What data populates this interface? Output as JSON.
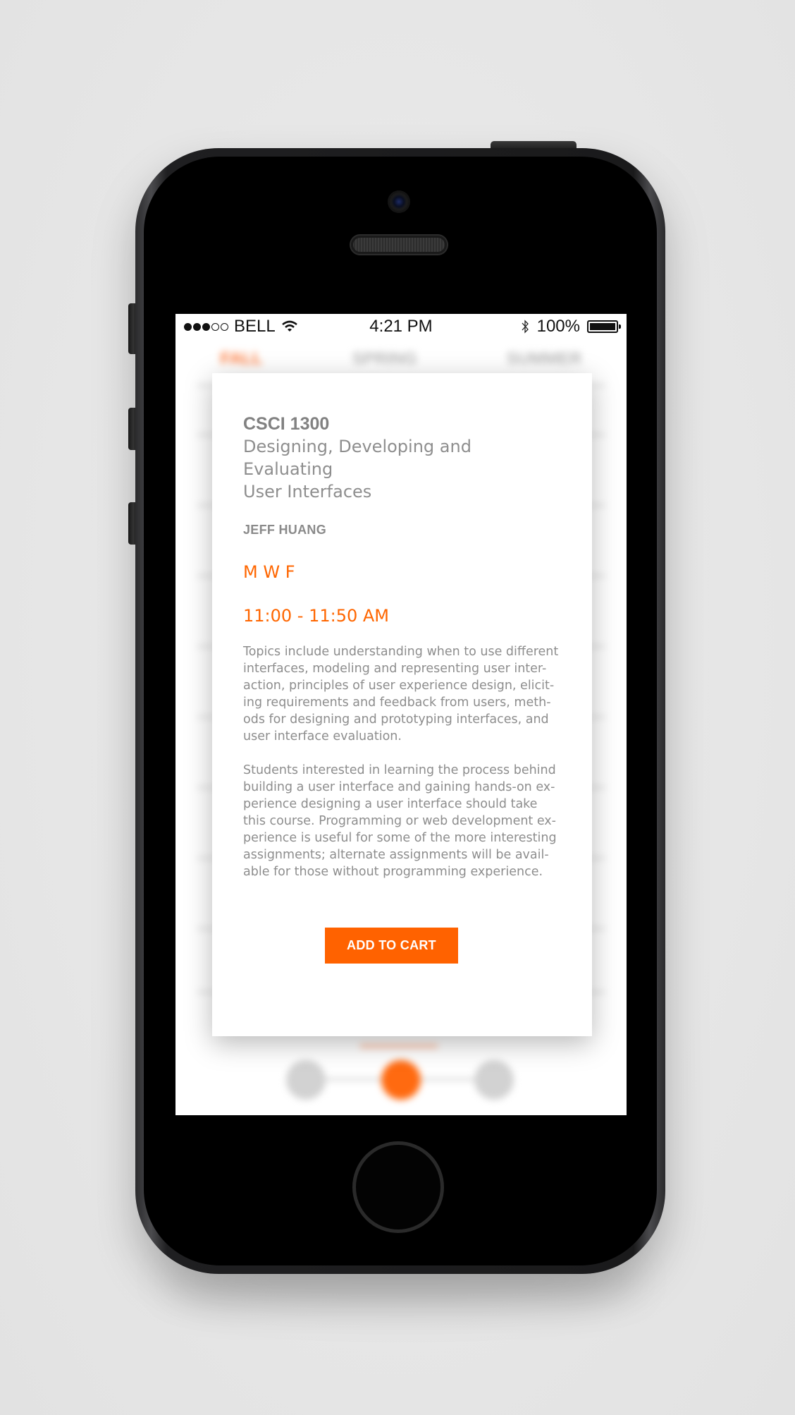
{
  "status_bar": {
    "carrier": "BELL",
    "time": "4:21 PM",
    "battery_percent": "100%",
    "signal_bars_filled": 3,
    "signal_bars_total": 5
  },
  "background_app": {
    "tabs": [
      {
        "label": "FALL",
        "active": true
      },
      {
        "label": "SPRING",
        "active": false
      },
      {
        "label": "SUMMER",
        "active": false
      }
    ],
    "pager": {
      "active_index": 1,
      "count": 3
    }
  },
  "course_modal": {
    "code": "CSCI 1300",
    "title_line1": "Designing, Developing and Evaluating",
    "title_line2": "User Interfaces",
    "instructor": "JEFF HUANG",
    "days": "M W F",
    "time": "11:00 - 11:50 AM",
    "description_1": "Topics include understanding when to use different interfaces, modeling and representing user inter-action, principles of user experience design, elicit-ing requirements and feedback from users, meth-ods for designing and prototyping interfaces, and user interface evaluation.",
    "description_2": "Students interested in learning the process behind building a user interface and gaining hands-on ex-perience designing a user interface should take this course. Programming or web development ex-perience is useful for some of the more interesting assignments; alternate assignments will be avail-able for those without programming experience.",
    "add_button_label": "ADD TO CART"
  },
  "colors": {
    "accent": "#ff6200",
    "text_gray": "#8d8d8d",
    "background": "#e7e7e7"
  },
  "icons": [
    "wifi-icon",
    "bluetooth-icon",
    "battery-icon",
    "signal-dots-icon"
  ]
}
